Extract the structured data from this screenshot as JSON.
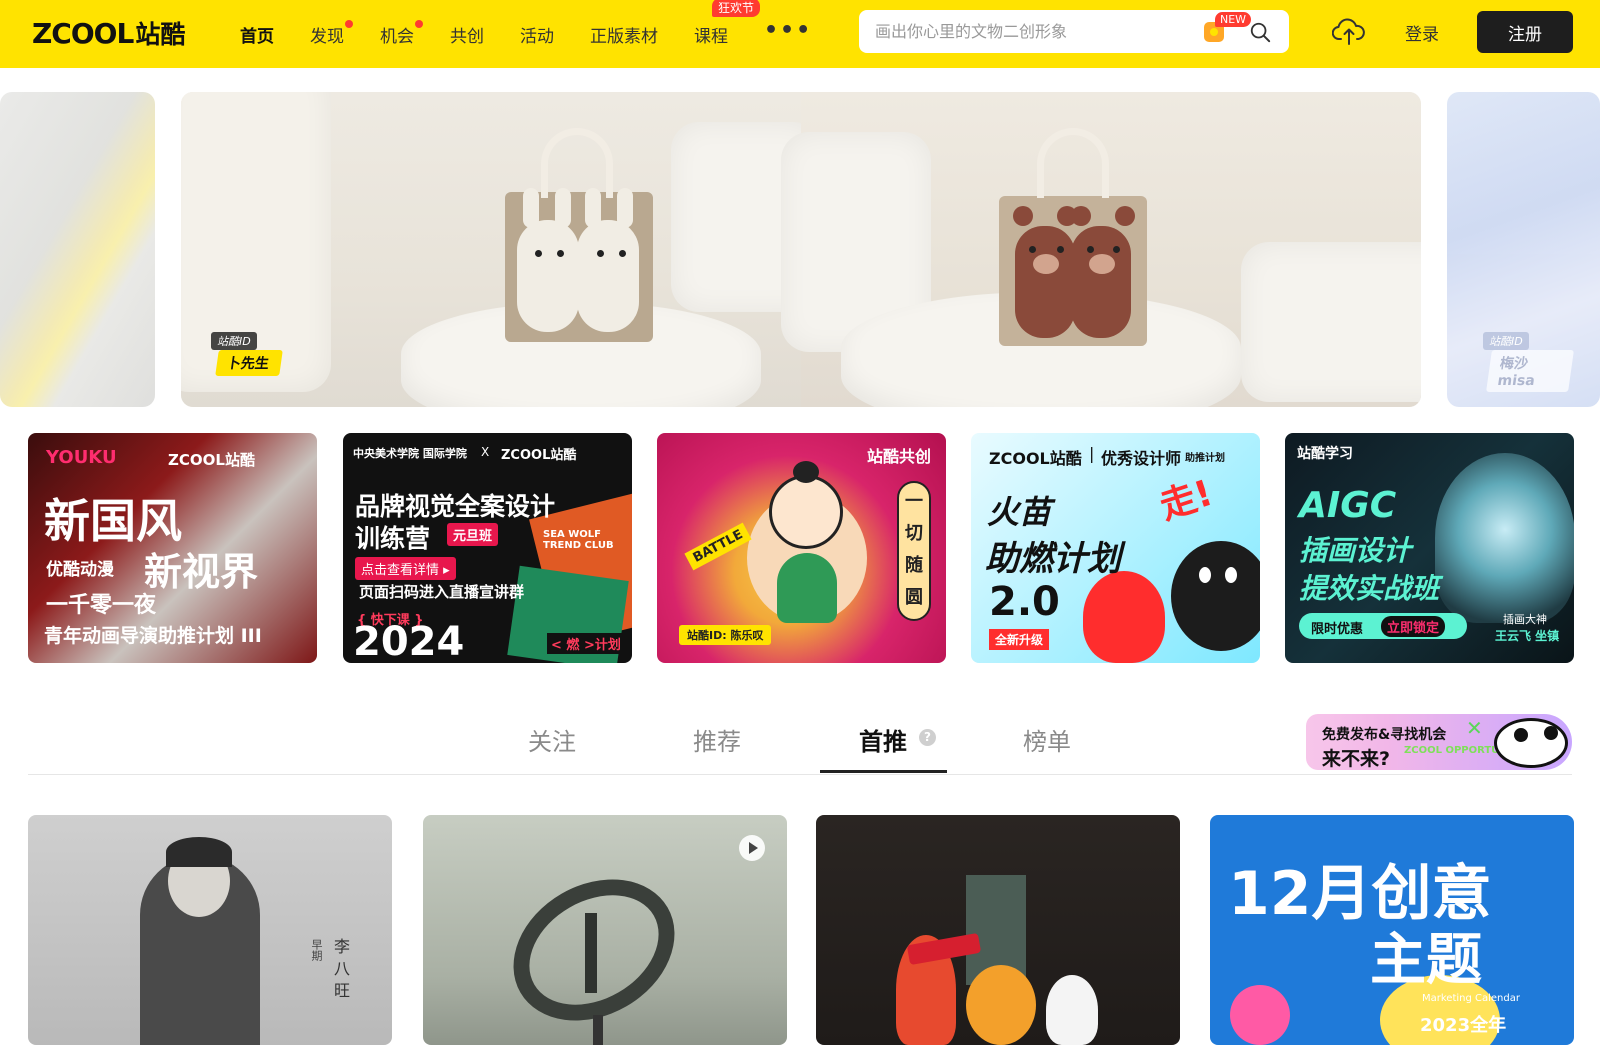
{
  "header": {
    "logo_en": "ZCOOL",
    "logo_cn": "站酷",
    "nav": [
      {
        "label": "首页",
        "active": true
      },
      {
        "label": "发现",
        "dot": true
      },
      {
        "label": "机会",
        "dot": true
      },
      {
        "label": "共创"
      },
      {
        "label": "活动"
      },
      {
        "label": "正版素材"
      },
      {
        "label": "课程",
        "badge": "狂欢节"
      }
    ],
    "more": "•••",
    "search_placeholder": "画出你心里的文物二创形象",
    "search_badge": "NEW",
    "login": "登录",
    "register": "注册",
    "accent_color": "#ffe300"
  },
  "hero": {
    "left_tag": {
      "top": "站酷ID",
      "name": "卜先生"
    },
    "right_tag": {
      "top": "站酷ID",
      "name": "梅沙misa"
    }
  },
  "banners": [
    {
      "partner": "YOUKU",
      "brand": "ZCOOL站酷",
      "title": "新国风",
      "subtitle": "新视界",
      "line1": "优酷动漫",
      "line2": "一千零一夜",
      "line3": "青年动画导演助推计划 III"
    },
    {
      "header_left": "中央美术学院 国际学院",
      "header_x": "X",
      "header_brand": "ZCOOL站酷",
      "title1": "品牌视觉全案设计",
      "title2": "训练营",
      "tag": "元旦班",
      "cta": "点击查看详情 ▸",
      "line": "页面扫码进入直播宣讲群",
      "course_tag": "{ 快下课 }",
      "year": "2024",
      "plan": "< 燃 >计划",
      "side": "SEA WOLF TREND CLUB"
    },
    {
      "label": "站酷共创",
      "vertical": [
        "一",
        "切",
        "随",
        "圆"
      ],
      "battle": "BATTLE",
      "author": "站酷ID: 陈乐叹"
    },
    {
      "brand": "ZCOOL站酷",
      "sep": "|",
      "program": "优秀设计师",
      "program_sub": "助推计划",
      "title1": "火苗",
      "title2": "助燃计划",
      "version": "2.0",
      "upgrade": "全新升级",
      "shout": "走!"
    },
    {
      "label": "站酷学习",
      "title1": "AIGC",
      "title2": "插画设计",
      "title3": "提效实战班",
      "promo": "限时优惠",
      "lock": "立即锁定",
      "teacher_role": "插画大神",
      "teacher": "王云飞 坐镇"
    }
  ],
  "tabs": [
    {
      "label": "关注"
    },
    {
      "label": "推荐"
    },
    {
      "label": "首推",
      "active": true
    },
    {
      "label": "榜单"
    }
  ],
  "help_glyph": "?",
  "promo_card": {
    "line1": "免费发布&寻找机会",
    "line2": "来不来?",
    "line3": "ZCOOL OPPORTUNITIES"
  },
  "works": [
    {
      "type": "image",
      "caption_v1": "李",
      "caption_v2": "八",
      "caption_v3": "旺",
      "side_text": "早期"
    },
    {
      "type": "video"
    },
    {
      "type": "image"
    },
    {
      "type": "image",
      "title1": "12月创意",
      "title2": "主题",
      "subtitle": "Marketing Calendar",
      "year": "2023全年"
    }
  ]
}
